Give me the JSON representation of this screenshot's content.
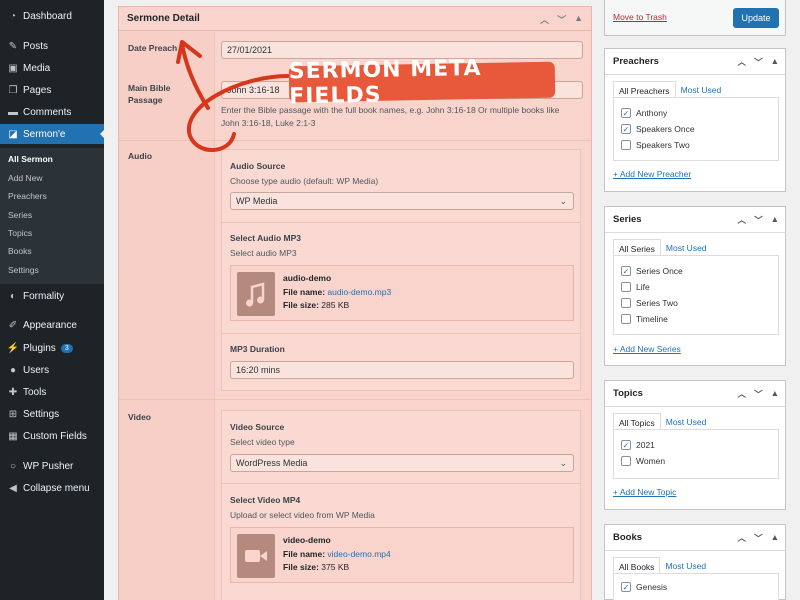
{
  "sidebar": {
    "items": [
      {
        "label": "Dashboard",
        "icon": "dashboard-icon"
      },
      {
        "label": "Posts",
        "icon": "pin-icon"
      },
      {
        "label": "Media",
        "icon": "media-icon"
      },
      {
        "label": "Pages",
        "icon": "pages-icon"
      },
      {
        "label": "Comments",
        "icon": "comment-icon"
      },
      {
        "label": "Sermon'e",
        "icon": "sermone-icon"
      },
      {
        "label": "Formality",
        "icon": "toggle-icon"
      },
      {
        "label": "Appearance",
        "icon": "brush-icon"
      },
      {
        "label": "Plugins",
        "icon": "plugin-icon",
        "badge": "3"
      },
      {
        "label": "Users",
        "icon": "user-icon"
      },
      {
        "label": "Tools",
        "icon": "wrench-icon"
      },
      {
        "label": "Settings",
        "icon": "settings-icon"
      },
      {
        "label": "Custom Fields",
        "icon": "grid-icon"
      },
      {
        "label": "WP Pusher",
        "icon": "circle-icon"
      },
      {
        "label": "Collapse menu",
        "icon": "collapse-icon"
      }
    ],
    "submenu": [
      "All Sermon",
      "Add New",
      "Preachers",
      "Series",
      "Topics",
      "Books",
      "Settings"
    ]
  },
  "metabox": {
    "title": "Sermone Detail",
    "date_label": "Date Preach",
    "date_value": "27/01/2021",
    "bible_label_1": "Main Bible",
    "bible_label_2": "Passage",
    "bible_value": "John 3:16-18",
    "bible_help_1": "Enter the Bible passage with the full book names, e.g. John 3:16-18 Or multiple books like",
    "bible_help_2": "John 3:16-18, Luke 2:1-3",
    "audio_label": "Audio",
    "audio_source_title": "Audio Source",
    "audio_source_desc": "Choose type audio (default: WP Media)",
    "audio_source_value": "WP Media",
    "audio_mp3_title": "Select Audio MP3",
    "audio_mp3_desc": "Select audio MP3",
    "audio_file_title": "audio-demo",
    "audio_file_name_label": "File name:",
    "audio_file_name": "audio-demo.mp3",
    "audio_file_size_label": "File size:",
    "audio_file_size": "285 KB",
    "mp3_duration_title": "MP3 Duration",
    "mp3_duration_value": "16:20 mins",
    "video_label": "Video",
    "video_source_title": "Video Source",
    "video_source_desc": "Select video type",
    "video_source_value": "WordPress Media",
    "video_mp4_title": "Select Video MP4",
    "video_mp4_desc": "Upload or select video from WP Media",
    "video_file_title": "video-demo",
    "video_file_name_label": "File name:",
    "video_file_name": "video-demo.mp4",
    "video_file_size_label": "File size:",
    "video_file_size": "375 KB"
  },
  "annotation": "SERMON META FIELDS",
  "publish": {
    "trash": "Move to Trash",
    "update": "Update"
  },
  "preachers": {
    "title": "Preachers",
    "tab_all": "All Preachers",
    "tab_used": "Most Used",
    "items": [
      {
        "label": "Anthony",
        "checked": true
      },
      {
        "label": "Speakers Once",
        "checked": true
      },
      {
        "label": "Speakers Two",
        "checked": false
      }
    ],
    "add": "+ Add New Preacher"
  },
  "series": {
    "title": "Series",
    "tab_all": "All Series",
    "tab_used": "Most Used",
    "items": [
      {
        "label": "Series Once",
        "checked": true
      },
      {
        "label": "Life",
        "checked": false
      },
      {
        "label": "Series Two",
        "checked": false
      },
      {
        "label": "Timeline",
        "checked": false
      }
    ],
    "add": "+ Add New Series"
  },
  "topics": {
    "title": "Topics",
    "tab_all": "All Topics",
    "tab_used": "Most Used",
    "items": [
      {
        "label": "2021",
        "checked": true
      },
      {
        "label": "Women",
        "checked": false
      }
    ],
    "add": "+ Add New Topic"
  },
  "books": {
    "title": "Books",
    "tab_all": "All Books",
    "tab_used": "Most Used",
    "items": [
      {
        "label": "Genesis",
        "checked": true
      }
    ]
  },
  "colors": {
    "accent": "#2271b1",
    "annotation": "#e8583b",
    "metabox_bg": "#f9d4cc",
    "sidebar_bg": "#1d2327"
  }
}
